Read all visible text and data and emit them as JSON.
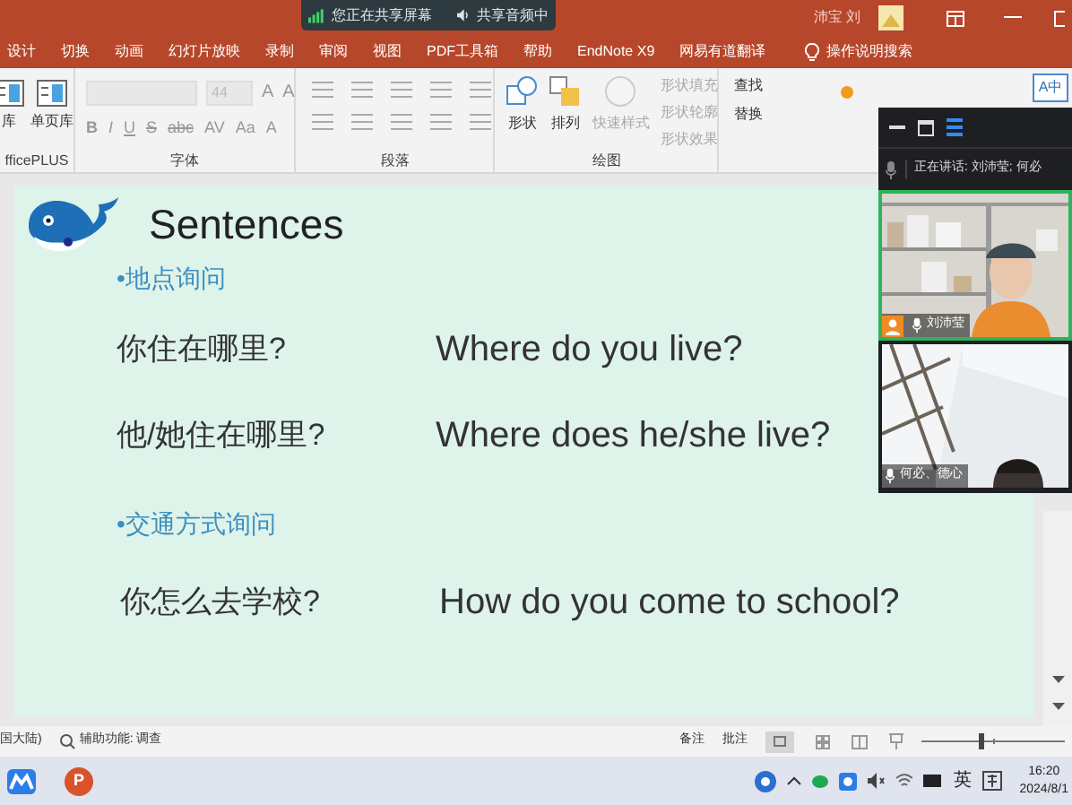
{
  "title_bar": {
    "share_status": "您正在共享屏幕",
    "audio_status": "共享音频中",
    "user_name": "沛宝 刘"
  },
  "tabs": [
    {
      "label": "设计",
      "selected": false
    },
    {
      "label": "切换",
      "selected": false
    },
    {
      "label": "动画",
      "selected": false
    },
    {
      "label": "幻灯片放映",
      "selected": false
    },
    {
      "label": "录制",
      "selected": false
    },
    {
      "label": "审阅",
      "selected": false
    },
    {
      "label": "视图",
      "selected": false
    },
    {
      "label": "PDF工具箱",
      "selected": false
    },
    {
      "label": "帮助",
      "selected": false
    },
    {
      "label": "EndNote X9",
      "selected": false
    },
    {
      "label": "网易有道翻译",
      "selected": false
    }
  ],
  "search_hint": "操作说明搜索",
  "ribbon": {
    "slides_group": {
      "buttons": [
        "库",
        "单页库"
      ],
      "label": "fficePLUS"
    },
    "font_group": {
      "font_size": "44",
      "size_buttons": [
        "A",
        "A"
      ],
      "format_buttons": [
        "B",
        "I",
        "U",
        "S",
        "abc",
        "AV",
        "Aa",
        "A"
      ],
      "label": "字体"
    },
    "paragraph_group": {
      "label": "段落"
    },
    "drawing_group": {
      "buttons": [
        "形状",
        "排列",
        "快速样式"
      ],
      "options": [
        "形状填充",
        "形状轮廓",
        "形状效果"
      ],
      "label": "绘图"
    },
    "editing_group": {
      "buttons": [
        "查找",
        "替换"
      ]
    },
    "translate_letters": [
      "A",
      "中"
    ]
  },
  "meeting_panel": {
    "speaking": "正在讲话: 刘沛莹; 何必",
    "videos": [
      {
        "name": "刘沛莹",
        "selected": true,
        "kind": "bookshelf"
      },
      {
        "name": "何必、德心",
        "selected": false,
        "kind": "window"
      }
    ]
  },
  "slide": {
    "title": "Sentences",
    "sections": [
      {
        "heading": "•地点询问",
        "rows": [
          {
            "chinese": "你住在哪里?",
            "english": "Where do you live?"
          },
          {
            "chinese": "他/她住在哪里?",
            "english": "Where does he/she live?"
          }
        ]
      },
      {
        "heading": "•交通方式询问",
        "rows": [
          {
            "chinese": "你怎么去学校?",
            "english": "How do you come to school?"
          }
        ]
      }
    ]
  },
  "status_bar": {
    "language": "国大陆)",
    "accessibility": "辅助功能: 调查",
    "notes": "备注",
    "comments": "批注",
    "zoom_slider": {
      "level": 0.42
    }
  },
  "taskbar": {
    "app_letter": "P",
    "ime": "英",
    "time": "16:20",
    "date": "2024/8/1"
  }
}
